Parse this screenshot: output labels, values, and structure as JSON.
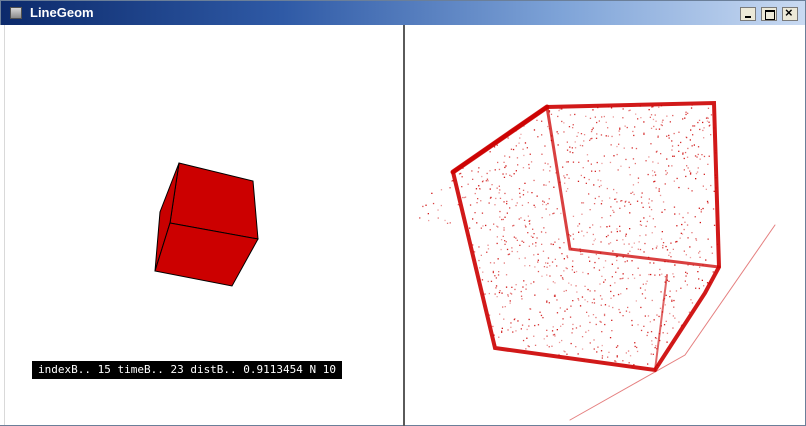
{
  "window": {
    "title": "LineGeom",
    "controls": [
      "minimize",
      "maximize",
      "close"
    ],
    "close_glyph": "×"
  },
  "status_bar": {
    "text": "indexB.. 15 timeB.. 23 distB.. 0.9113454 N 10"
  },
  "colors": {
    "cube_face": "#cc0000",
    "cube_edge": "#000000",
    "point_cloud": "#cc0000",
    "titlebar_start": "#0c2a6b",
    "titlebar_end": "#c9daf2"
  },
  "icons": [
    "app-icon",
    "minimize-icon",
    "maximize-icon",
    "close-icon"
  ]
}
